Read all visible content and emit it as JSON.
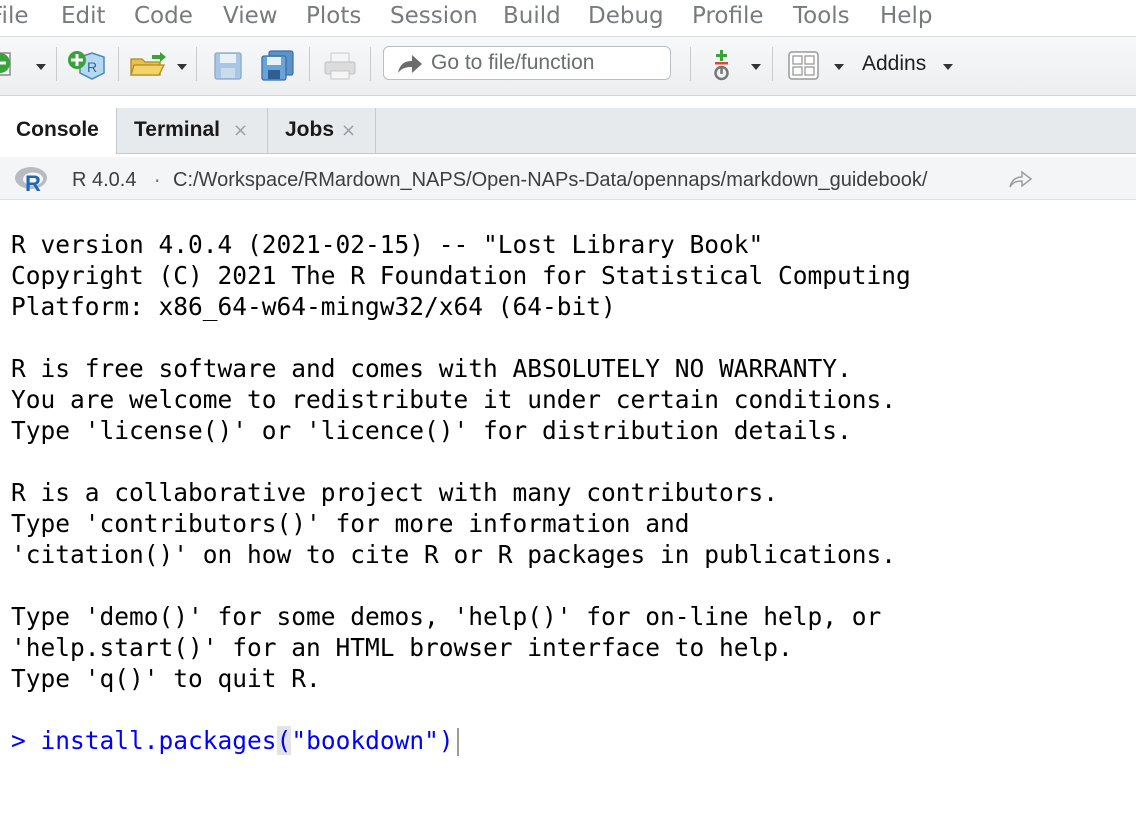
{
  "menubar": {
    "items": [
      "File",
      "Edit",
      "Code",
      "View",
      "Plots",
      "Session",
      "Build",
      "Debug",
      "Profile",
      "Tools",
      "Help"
    ]
  },
  "toolbar": {
    "goto_placeholder": "Go to file/function",
    "addins_label": "Addins",
    "icons": [
      "new-file-icon",
      "new-project-icon",
      "open-folder-icon",
      "save-icon",
      "save-all-icon",
      "print-icon",
      "arrow-right-icon",
      "git-icon",
      "grid-layout-icon"
    ]
  },
  "tabs": [
    {
      "label": "Console",
      "active": true
    },
    {
      "label": "Terminal",
      "close": "×"
    },
    {
      "label": "Jobs",
      "close": "×"
    }
  ],
  "pathbar": {
    "r_version": "R 4.0.4",
    "separator": "·",
    "path": "C:/Workspace/RMardown_NAPS/Open-NAPs-Data/opennaps/markdown_guidebook/"
  },
  "console": {
    "lines": [
      "R version 4.0.4 (2021-02-15) -- \"Lost Library Book\"",
      "Copyright (C) 2021 The R Foundation for Statistical Computing",
      "Platform: x86_64-w64-mingw32/x64 (64-bit)",
      "",
      "R is free software and comes with ABSOLUTELY NO WARRANTY.",
      "You are welcome to redistribute it under certain conditions.",
      "Type 'license()' or 'licence()' for distribution details.",
      "",
      "R is a collaborative project with many contributors.",
      "Type 'contributors()' for more information and",
      "'citation()' on how to cite R or R packages in publications.",
      "",
      "Type 'demo()' for some demos, 'help()' for on-line help, or",
      "'help.start()' for an HTML browser interface to help.",
      "Type 'q()' to quit R.",
      ""
    ],
    "prompt": ">",
    "input_before": "install.packages",
    "input_paren": "(",
    "input_after": "\"bookdown\")"
  },
  "colors": {
    "prompt": "#0000ff",
    "menu_text": "#777a7e",
    "r_logo_blue": "#2266b8"
  }
}
